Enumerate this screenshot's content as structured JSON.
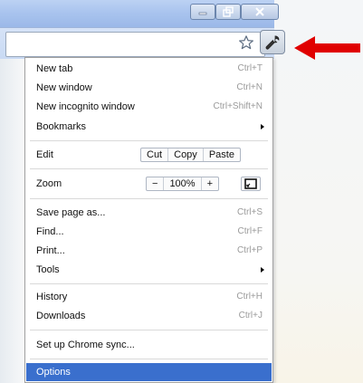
{
  "window": {
    "minimize_icon": "minimize-icon",
    "restore_icon": "restore-icon",
    "close_icon": "close-icon"
  },
  "toolbar": {
    "bookmark_icon": "star-icon",
    "menu_icon": "wrench-icon",
    "annotation": "red-arrow"
  },
  "menu": {
    "new_tab": {
      "label": "New tab",
      "shortcut": "Ctrl+T"
    },
    "new_window": {
      "label": "New window",
      "shortcut": "Ctrl+N"
    },
    "new_incognito": {
      "label": "New incognito window",
      "shortcut": "Ctrl+Shift+N"
    },
    "bookmarks": {
      "label": "Bookmarks"
    },
    "edit": {
      "label": "Edit",
      "cut": "Cut",
      "copy": "Copy",
      "paste": "Paste"
    },
    "zoom": {
      "label": "Zoom",
      "minus": "−",
      "value": "100%",
      "plus": "+"
    },
    "save_page": {
      "label": "Save page as...",
      "shortcut": "Ctrl+S"
    },
    "find": {
      "label": "Find...",
      "shortcut": "Ctrl+F"
    },
    "print": {
      "label": "Print...",
      "shortcut": "Ctrl+P"
    },
    "tools": {
      "label": "Tools"
    },
    "history": {
      "label": "History",
      "shortcut": "Ctrl+H"
    },
    "downloads": {
      "label": "Downloads",
      "shortcut": "Ctrl+J"
    },
    "sync": {
      "label": "Set up Chrome sync..."
    },
    "options": {
      "label": "Options"
    }
  },
  "colors": {
    "selection": "#3a6fcd",
    "arrow": "#e00000"
  }
}
